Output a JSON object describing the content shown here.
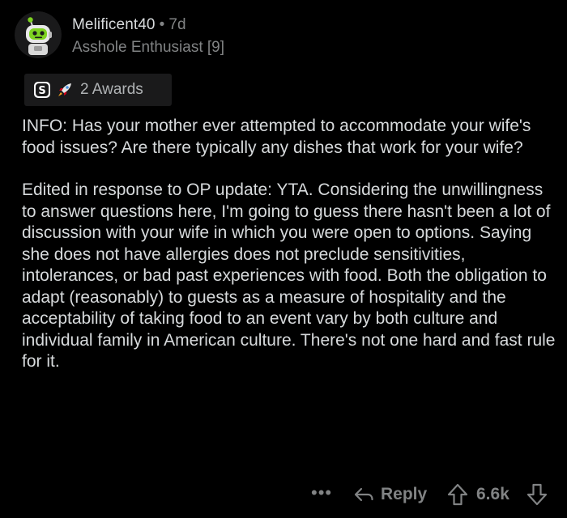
{
  "comment": {
    "author": "Melificent40",
    "separator": "•",
    "age": "7d",
    "flair": "Asshole Enthusiast [9]",
    "awards": {
      "icons": [
        "silver-award-icon",
        "rocket-award-icon"
      ],
      "label": "2 Awards"
    },
    "body": [
      "INFO:  Has your mother ever attempted to accommodate your wife's food issues?  Are there typically any dishes that work for your wife?",
      "Edited in response to OP update:  YTA.  Considering the unwillingness to answer questions here, I'm going to guess there hasn't been a lot of discussion with your wife in which you were open to options.  Saying she does not have allergies does not preclude sensitivities, intolerances, or bad past experiences with food.  Both the obligation to adapt (reasonably) to guests as a measure of hospitality and the acceptability of taking food to an event vary by both culture and individual family in American culture.  There's not one hard and fast rule for it."
    ],
    "actions": {
      "more": "•••",
      "reply": "Reply",
      "score": "6.6k"
    }
  },
  "colors": {
    "background": "#000000",
    "text": "#d7dadc",
    "muted": "#818384",
    "awards_bg": "#1a1a1b",
    "avatar_bg": "#1a1a1b",
    "avatar_accent": "#7ed321"
  }
}
